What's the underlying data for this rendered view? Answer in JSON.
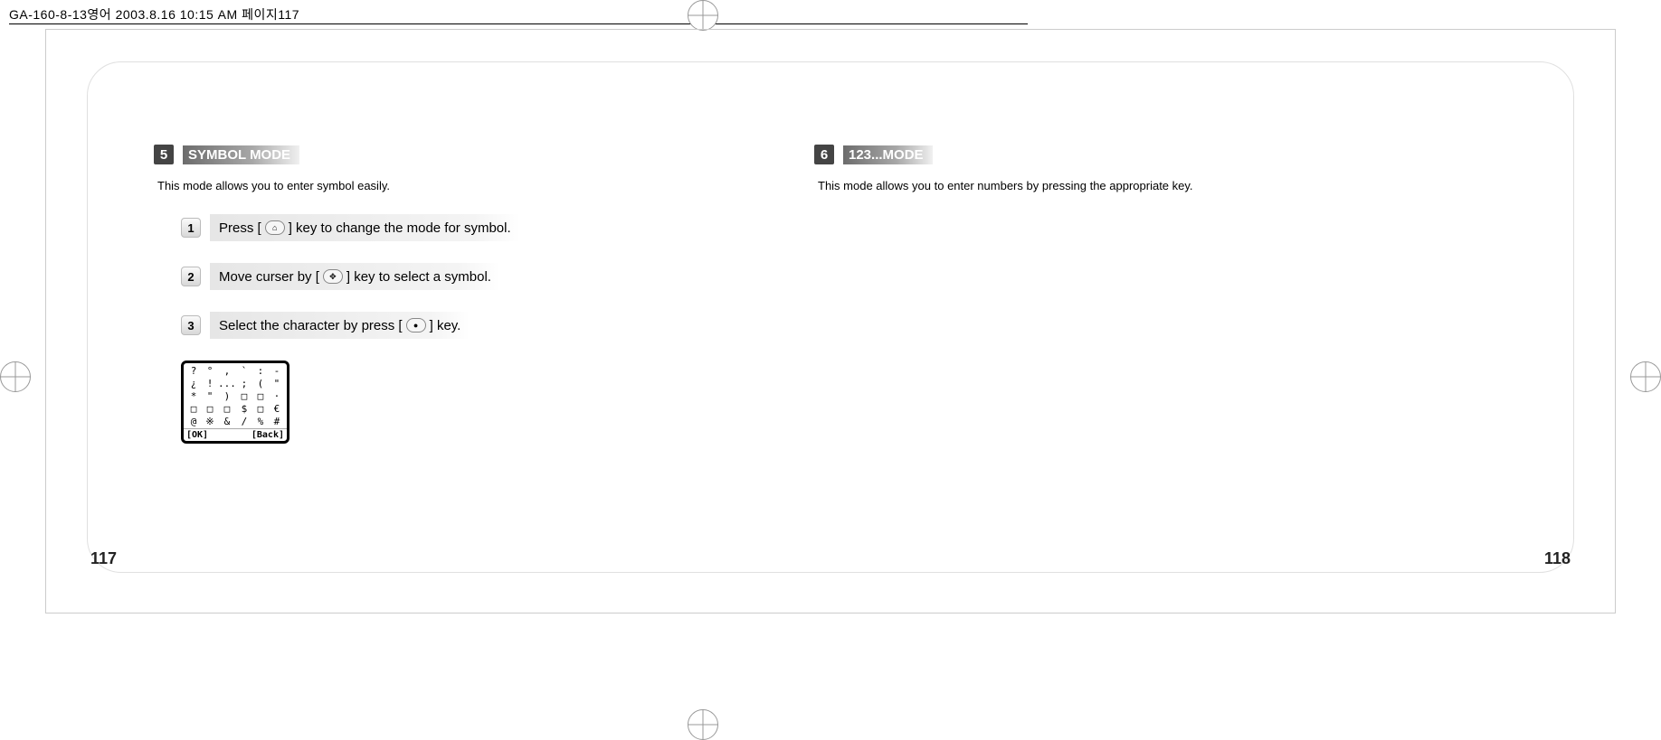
{
  "header": {
    "file_info": "GA-160-8-13영어   2003.8.16 10:15 AM   페이지117"
  },
  "pages": {
    "left": "117",
    "right": "118"
  },
  "left_section": {
    "number": "5",
    "title": "SYMBOL MODE",
    "intro": "This mode allows you to enter symbol easily.",
    "steps": [
      {
        "num": "1",
        "pre": "Press [",
        "post": "] key to change the mode for symbol."
      },
      {
        "num": "2",
        "pre": "Move curser by [",
        "post": "] key to select a symbol."
      },
      {
        "num": "3",
        "pre": "Select the character by press [",
        "post": "] key."
      }
    ],
    "screen": {
      "symbols": [
        "?",
        "°",
        "",
        "",
        "",
        "",
        "",
        "",
        "",
        ":",
        "-",
        "¿",
        "!",
        "...",
        ";",
        "(",
        "\"",
        "*",
        "\"",
        ")",
        "",
        "",
        "·",
        "",
        "",
        "",
        "$",
        "",
        "€",
        "@",
        "※",
        "&",
        "/",
        "%",
        "#"
      ],
      "left_soft": "[OK]",
      "right_soft": "[Back]"
    }
  },
  "right_section": {
    "number": "6",
    "title": "123...MODE",
    "intro": "This mode allows you to enter numbers by pressing the appropriate key."
  }
}
